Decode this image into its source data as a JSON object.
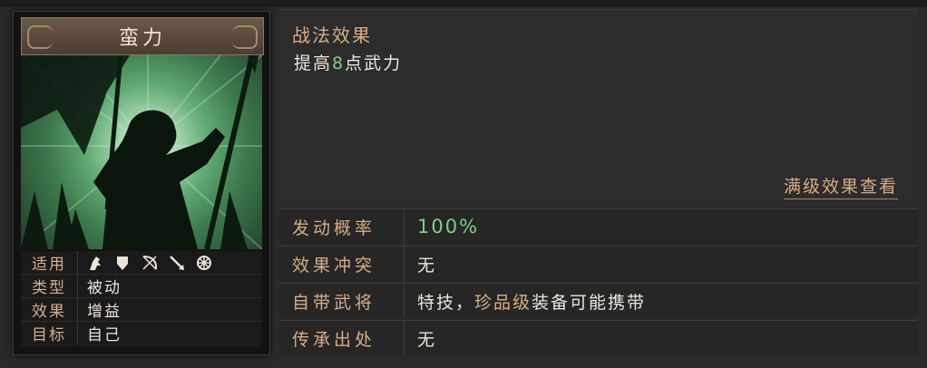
{
  "card": {
    "title": "蛮力",
    "attributes": [
      {
        "label": "适用",
        "icons": [
          "cavalry-icon",
          "shield-icon",
          "bow-icon",
          "spear-icon",
          "siege-wheel-icon"
        ]
      },
      {
        "label": "类型",
        "value": "被动"
      },
      {
        "label": "效果",
        "value": "增益"
      },
      {
        "label": "目标",
        "value": "自己"
      }
    ]
  },
  "effect": {
    "heading": "战法效果",
    "description_pre": "提高",
    "description_num": "8",
    "description_post": "点武力",
    "max_level_link": "满级效果查看"
  },
  "info": {
    "rate": {
      "label": "发动概率",
      "value": "100%"
    },
    "conflict": {
      "label": "效果冲突",
      "value": "无"
    },
    "innate": {
      "label": "自带武将",
      "value_pre": "特技，",
      "value_gold": "珍品级",
      "value_post": "装备可能携带"
    },
    "inherit": {
      "label": "传承出处",
      "value": "无"
    }
  },
  "colors": {
    "accent_gold": "#d7ad84",
    "accent_green": "#7fcf86"
  }
}
